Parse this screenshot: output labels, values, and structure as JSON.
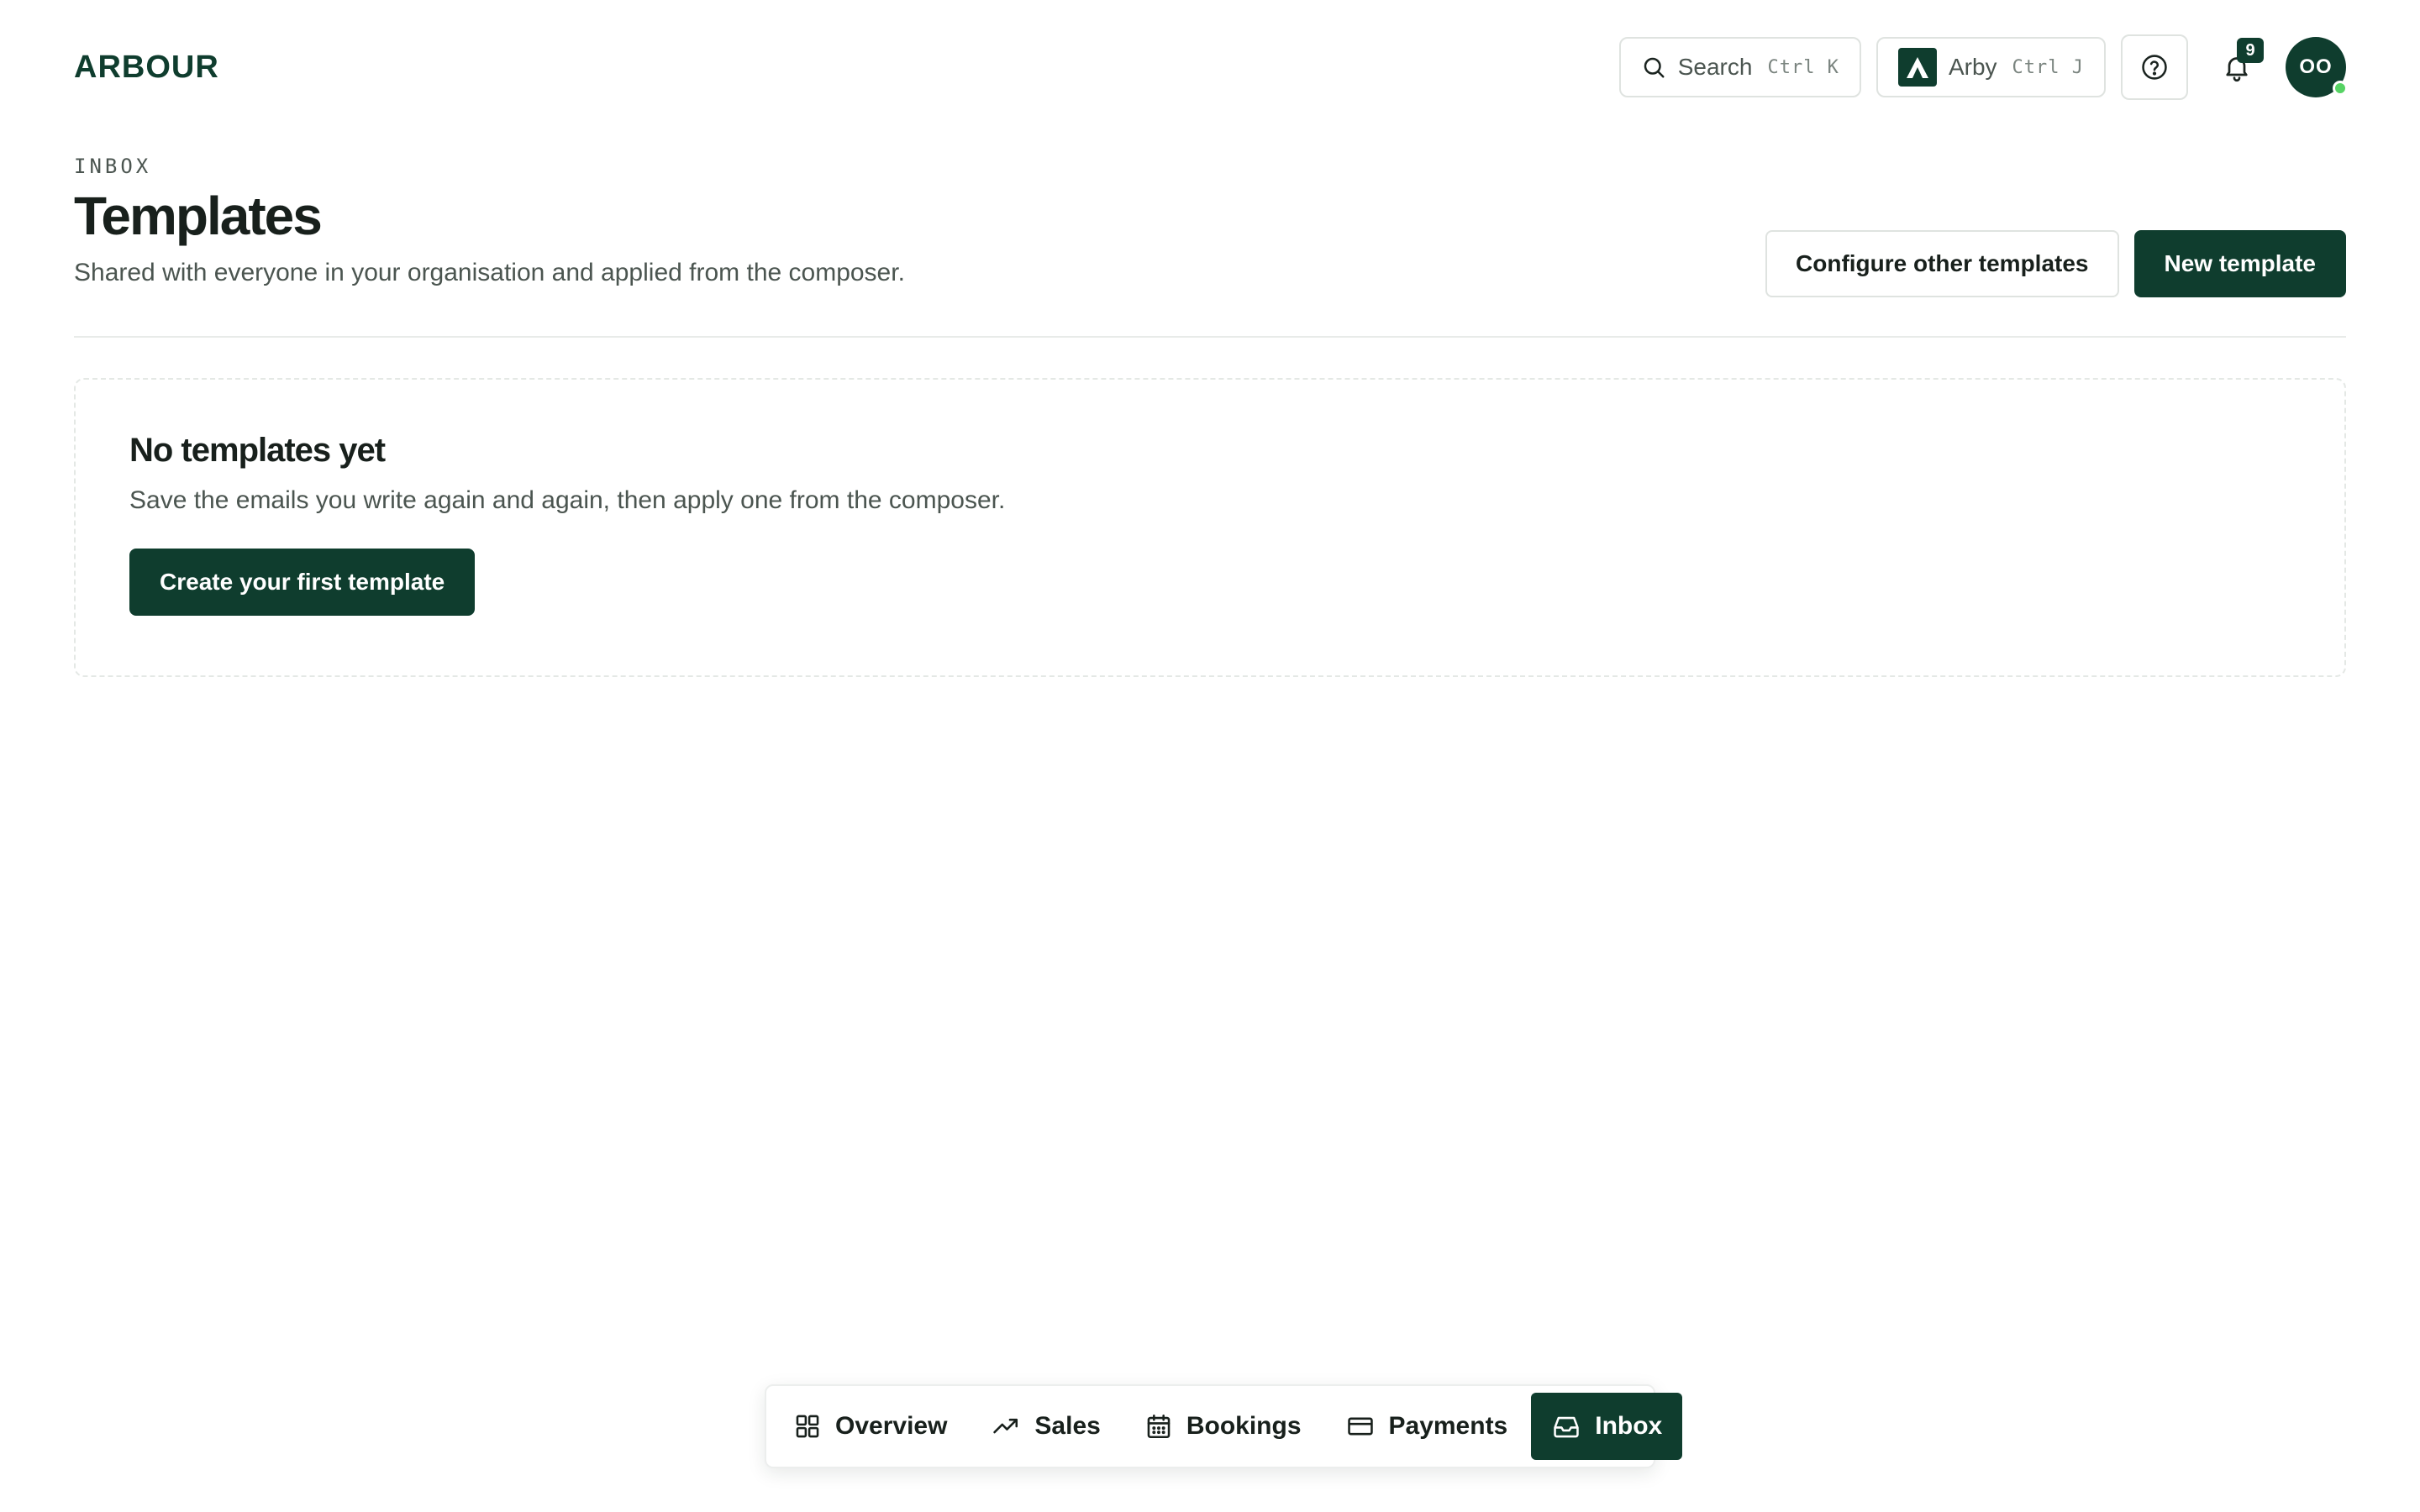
{
  "header": {
    "logo": "ARBOUR",
    "search": {
      "label": "Search",
      "shortcut": "Ctrl K"
    },
    "assistant": {
      "label": "Arby",
      "shortcut": "Ctrl J"
    },
    "notifications": {
      "count": "9"
    },
    "avatar": {
      "initials": "OO"
    }
  },
  "page": {
    "eyebrow": "INBOX",
    "title": "Templates",
    "subtitle": "Shared with everyone in your organisation and applied from the composer.",
    "actions": {
      "configure_label": "Configure other templates",
      "new_label": "New template"
    }
  },
  "empty_state": {
    "title": "No templates yet",
    "text": "Save the emails you write again and again, then apply one from the composer.",
    "cta_label": "Create your first template"
  },
  "bottom_nav": {
    "items": [
      {
        "label": "Overview",
        "icon": "grid-icon"
      },
      {
        "label": "Sales",
        "icon": "trending-up-icon"
      },
      {
        "label": "Bookings",
        "icon": "calendar-icon"
      },
      {
        "label": "Payments",
        "icon": "credit-card-icon"
      },
      {
        "label": "Inbox",
        "icon": "inbox-icon",
        "active": true
      }
    ]
  },
  "colors": {
    "brand": "#0f3d2e",
    "online": "#56d364",
    "border": "#dfe3e0"
  }
}
